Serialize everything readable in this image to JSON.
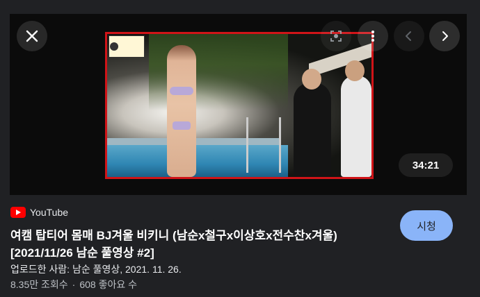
{
  "player": {
    "duration": "34:21",
    "close_icon": "close-icon",
    "lens_icon": "lens-icon",
    "more_icon": "more-vert-icon",
    "prev_icon": "chevron-left-icon",
    "next_icon": "chevron-right-icon"
  },
  "result": {
    "source_name": "YouTube",
    "title": "여캠 탑티어 몸매 BJ겨울 비키니 (남순x철구x이상호x전수찬x겨울) [2021/11/26 남순 풀영상 #2]",
    "uploader": "업로드한 사람: 남순 풀영상, 2021. 11. 26.",
    "views": "8.35만 조회수",
    "stats_separator": "·",
    "likes": "608 좋아요 수",
    "watch_label": "시청"
  },
  "colors": {
    "accent": "#8ab4f8",
    "youtube_red": "#ff0000",
    "thumbnail_border": "#d01418"
  }
}
